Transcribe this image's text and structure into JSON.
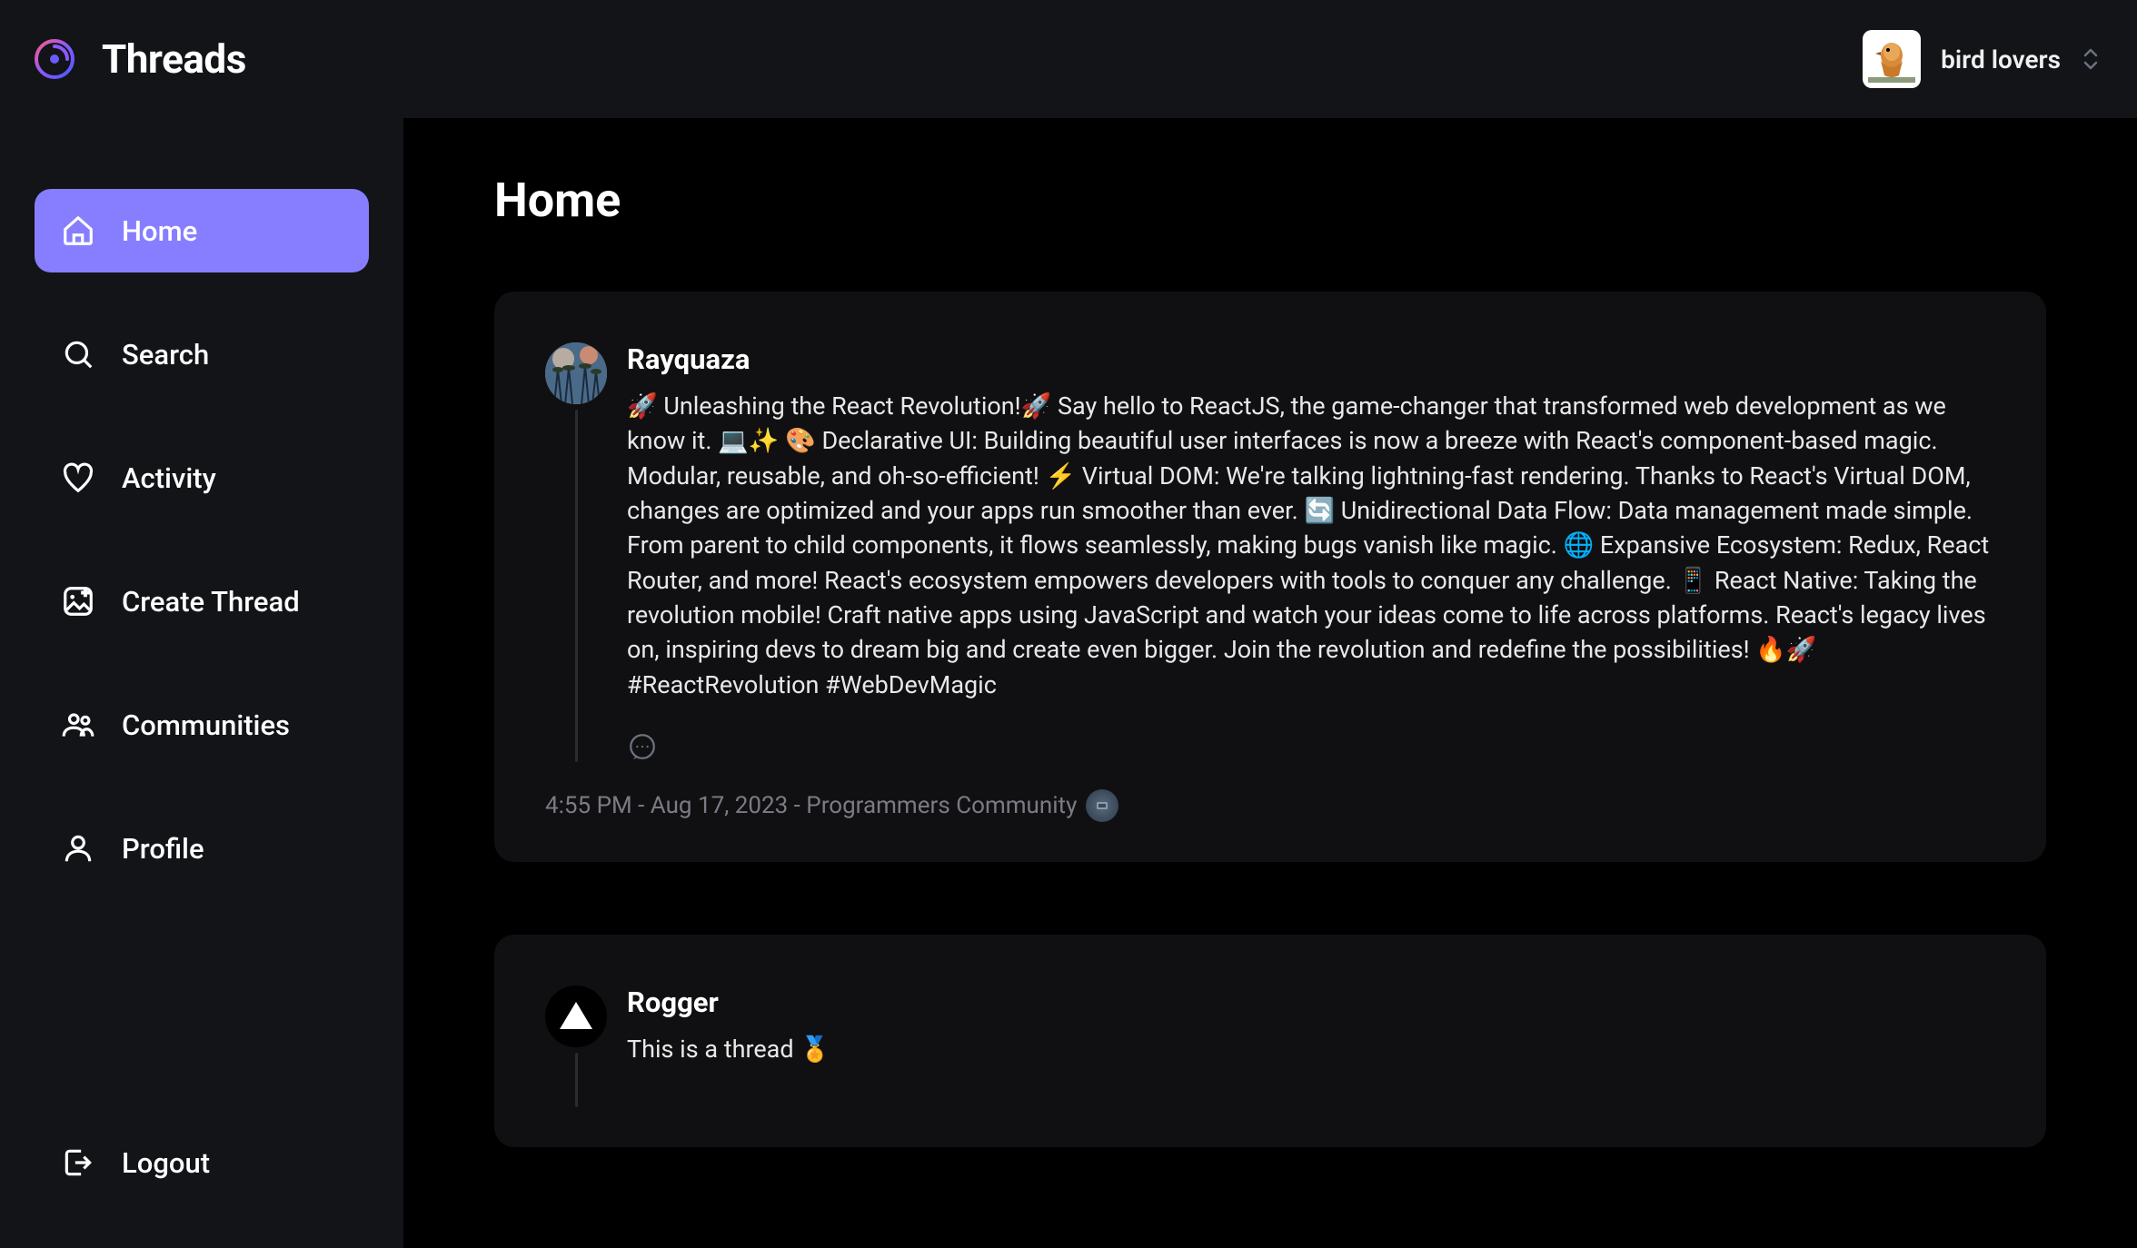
{
  "brand": {
    "title": "Threads"
  },
  "user": {
    "name": "bird lovers"
  },
  "sidebar": {
    "items": [
      {
        "key": "home",
        "label": "Home",
        "icon": "home-icon",
        "active": true
      },
      {
        "key": "search",
        "label": "Search",
        "icon": "search-icon",
        "active": false
      },
      {
        "key": "activity",
        "label": "Activity",
        "icon": "heart-icon",
        "active": false
      },
      {
        "key": "create-thread",
        "label": "Create Thread",
        "icon": "create-icon",
        "active": false
      },
      {
        "key": "communities",
        "label": "Communities",
        "icon": "communities-icon",
        "active": false
      },
      {
        "key": "profile",
        "label": "Profile",
        "icon": "profile-icon",
        "active": false
      }
    ],
    "logout": {
      "label": "Logout",
      "icon": "logout-icon"
    }
  },
  "page": {
    "title": "Home"
  },
  "feed": [
    {
      "author": "Rayquaza",
      "avatar": "palm",
      "body": "🚀 Unleashing the React Revolution!🚀 Say hello to ReactJS, the game-changer that transformed web development as we know it. 💻✨ 🎨 Declarative UI: Building beautiful user interfaces is now a breeze with React's component-based magic. Modular, reusable, and oh-so-efficient! ⚡ Virtual DOM: We're talking lightning-fast rendering. Thanks to React's Virtual DOM, changes are optimized and your apps run smoother than ever. 🔄 Unidirectional Data Flow: Data management made simple. From parent to child components, it flows seamlessly, making bugs vanish like magic. 🌐 Expansive Ecosystem: Redux, React Router, and more! React's ecosystem empowers developers with tools to conquer any challenge. 📱 React Native: Taking the revolution mobile! Craft native apps using JavaScript and watch your ideas come to life across platforms. React's legacy lives on, inspiring devs to dream big and create even bigger. Join the revolution and redefine the possibilities! 🔥🚀 #ReactRevolution #WebDevMagic",
      "meta": "4:55 PM - Aug 17, 2023 - Programmers Community",
      "showMeta": true
    },
    {
      "author": "Rogger",
      "avatar": "triangle",
      "body": "This is a thread 🏅",
      "meta": "",
      "showMeta": false
    }
  ]
}
